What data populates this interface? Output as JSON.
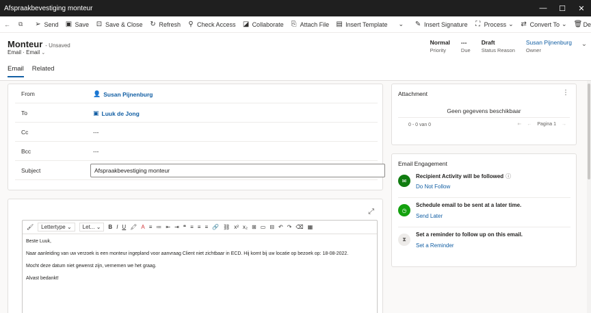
{
  "window": {
    "title": "Afspraakbevestiging monteur",
    "controls": [
      "—",
      "☐",
      "✕"
    ]
  },
  "commands": [
    {
      "name": "send",
      "label": "Send",
      "icon": "➢"
    },
    {
      "name": "save",
      "label": "Save",
      "icon": "▣"
    },
    {
      "name": "save-close",
      "label": "Save & Close",
      "icon": "⊡"
    },
    {
      "name": "refresh",
      "label": "Refresh",
      "icon": "↻"
    },
    {
      "name": "check-access",
      "label": "Check Access",
      "icon": "⚲"
    },
    {
      "name": "collaborate",
      "label": "Collaborate",
      "icon": "◪"
    },
    {
      "name": "attach-file",
      "label": "Attach File",
      "icon": "⎘"
    },
    {
      "name": "insert-template",
      "label": "Insert Template",
      "icon": "▤"
    },
    {
      "name": "insert-signature",
      "label": "Insert Signature",
      "icon": "✎"
    },
    {
      "name": "process",
      "label": "Process",
      "icon": "⛶"
    },
    {
      "name": "convert-to",
      "label": "Convert To",
      "icon": "⇄"
    },
    {
      "name": "delete",
      "label": "Delete",
      "icon": "🗑"
    }
  ],
  "nav_icons": {
    "back": "←",
    "popout": "⧉",
    "split": "⌄",
    "convert_chevron": "⌄"
  },
  "record": {
    "title": "Monteur",
    "unsaved": "- Unsaved",
    "type": "Email",
    "form": "Email",
    "form_chevron": "⌄"
  },
  "header_fields": [
    {
      "value": "Normal",
      "label": "Priority"
    },
    {
      "value": "---",
      "label": "Due"
    },
    {
      "value": "Draft",
      "label": "Status Reason"
    },
    {
      "value": "Susan Pijnenburg",
      "label": "Owner"
    }
  ],
  "header_chevron": "⌄",
  "tabs": [
    "Email",
    "Related"
  ],
  "fields": {
    "from": {
      "label": "From",
      "value": "Susan Pijnenburg",
      "icon": "👤"
    },
    "to": {
      "label": "To",
      "value": "Luuk de Jong",
      "icon": "▣"
    },
    "cc": {
      "label": "Cc",
      "value": "---"
    },
    "bcc": {
      "label": "Bcc",
      "value": "---"
    },
    "subject": {
      "label": "Subject",
      "value": "Afspraakbevestiging monteur"
    }
  },
  "editor": {
    "expand_icon": "⤢",
    "toolbar": {
      "format_painter": "🖌",
      "font": "Lettertype",
      "size": "Let...",
      "bold": "B",
      "italic": "I",
      "underline": "U",
      "highlight": "🖍",
      "font_color": "A",
      "more_tools": [
        "≡",
        "≔",
        "⇤",
        "⇥",
        "❝",
        "≡",
        "≡",
        "≡",
        "🔗",
        "⛓",
        "x²",
        "x₂",
        "⊞",
        "▭",
        "⊟",
        "↶",
        "↷",
        "⌫",
        "▦"
      ]
    },
    "body": [
      "Beste Luuk,",
      "Naar aanleiding van uw verzoek is een monteur ingepland voor aanvraag Client niet zichtbaar in ECD. Hij komt bij uw locatie op bezoek op: 18-08-2022.",
      "Mocht deze datum niet gewenst zijn, vernemen we het graag.",
      "Alvast bedankt!"
    ]
  },
  "attachment": {
    "title": "Attachment",
    "more": "⋮",
    "empty": "Geen gegevens beschikbaar",
    "count": "0 - 0 van 0",
    "first": "⇤",
    "prev": "←",
    "page": "Pagina 1",
    "next": "→"
  },
  "engagement": {
    "title": "Email Engagement",
    "items": [
      {
        "title": "Recipient Activity will be followed",
        "info": "ⓘ",
        "link": "Do Not Follow",
        "icon": "✉",
        "color": "#107c10"
      },
      {
        "title": "Schedule email to be sent at a later time.",
        "link": "Send Later",
        "icon": "◷",
        "color": "#13a10e"
      },
      {
        "title": "Set a reminder to follow up on this email.",
        "link": "Set a Reminder",
        "icon": "⧗",
        "color": "#edebe9"
      }
    ]
  }
}
